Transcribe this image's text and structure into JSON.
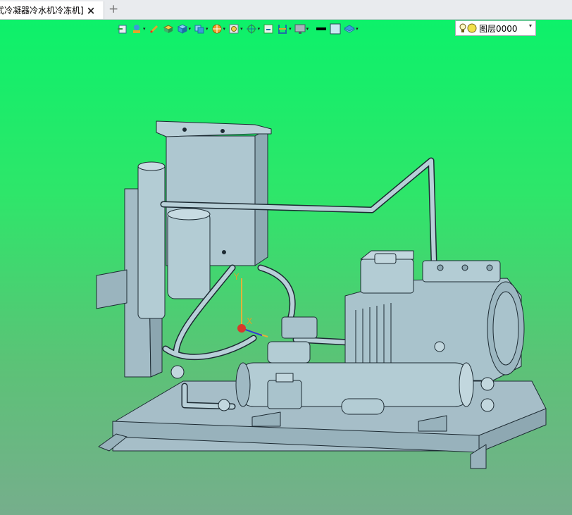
{
  "tabs": [
    {
      "title": "式冷凝器冷水机冷冻机]",
      "close": "×"
    }
  ],
  "add_tab": "+",
  "toolbar": {
    "items": [
      {
        "name": "import-icon",
        "dropdown": false
      },
      {
        "name": "model-tree-icon",
        "dropdown": true
      },
      {
        "name": "pencil-icon",
        "dropdown": false
      },
      {
        "name": "shaded-box-icon",
        "dropdown": false
      },
      {
        "name": "cube-icon",
        "dropdown": true
      },
      {
        "name": "view-cube-icon",
        "dropdown": true
      },
      {
        "name": "render-sphere-icon",
        "dropdown": true
      },
      {
        "name": "zoom-box-icon",
        "dropdown": true
      },
      {
        "name": "orbit-icon",
        "dropdown": true
      },
      {
        "name": "fit-view-icon",
        "dropdown": false
      },
      {
        "name": "section-view-icon",
        "dropdown": true
      },
      {
        "name": "monitor-icon",
        "dropdown": true
      },
      {
        "name": "line-color-icon",
        "dropdown": false
      },
      {
        "name": "fill-color-icon",
        "dropdown": false
      },
      {
        "name": "display-style-icon",
        "dropdown": true
      }
    ],
    "dropdown_glyph": "▾",
    "layer": {
      "label": "图层0000",
      "arrow": "▾"
    }
  },
  "colors": {
    "background_top": "#0df16a",
    "background_bottom": "#76ae8c",
    "model_fill": "#a9c3cc",
    "model_stroke": "#1d2b33",
    "triad_x": "#d93a2a",
    "triad_y": "#e0b43a",
    "triad_z": "#2a3fd6"
  },
  "triad": {
    "x_label": "X",
    "y_label": "Y"
  }
}
